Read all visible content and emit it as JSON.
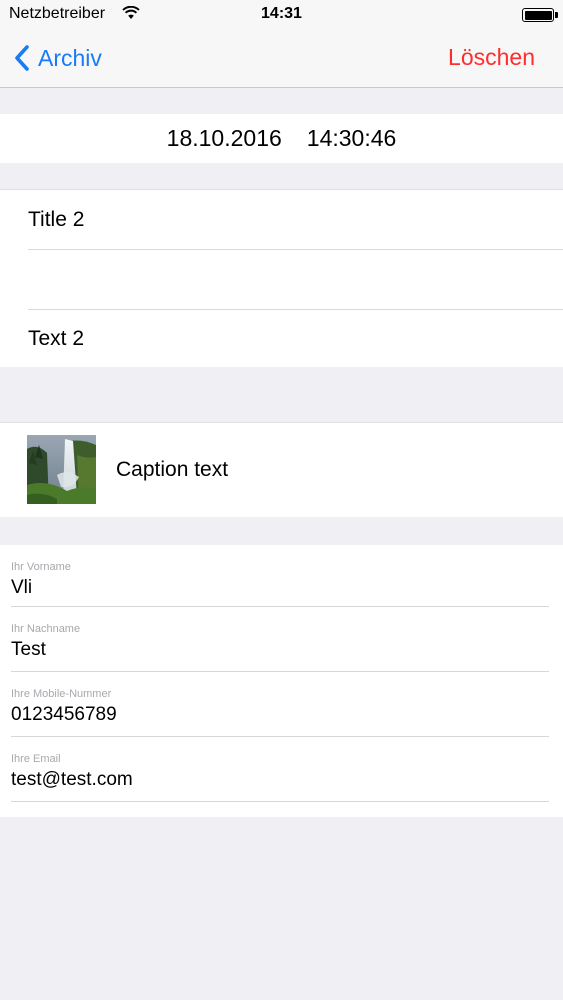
{
  "status_bar": {
    "carrier": "Netzbetreiber",
    "time": "14:31",
    "wifi_icon": "wifi-icon",
    "battery_icon": "battery-icon"
  },
  "nav": {
    "back_label": "Archiv",
    "back_icon": "chevron-left-icon",
    "delete_label": "Löschen",
    "accent_color": "#1a7cf5",
    "destructive_color": "#ff2d2d"
  },
  "entry": {
    "date": "18.10.2016",
    "time": "14:30:46",
    "title": "Title 2",
    "subtitle": "",
    "text": "Text 2",
    "image_caption": "Caption text",
    "image_icon": "waterfall-photo"
  },
  "form": {
    "first_name": {
      "label": "Ihr Vorname",
      "value": "Vli"
    },
    "last_name": {
      "label": "Ihr Nachname",
      "value": "Test"
    },
    "mobile": {
      "label": "Ihre Mobile-Nummer",
      "value": "0123456789"
    },
    "email": {
      "label": "Ihre Email",
      "value": "test@test.com"
    }
  }
}
